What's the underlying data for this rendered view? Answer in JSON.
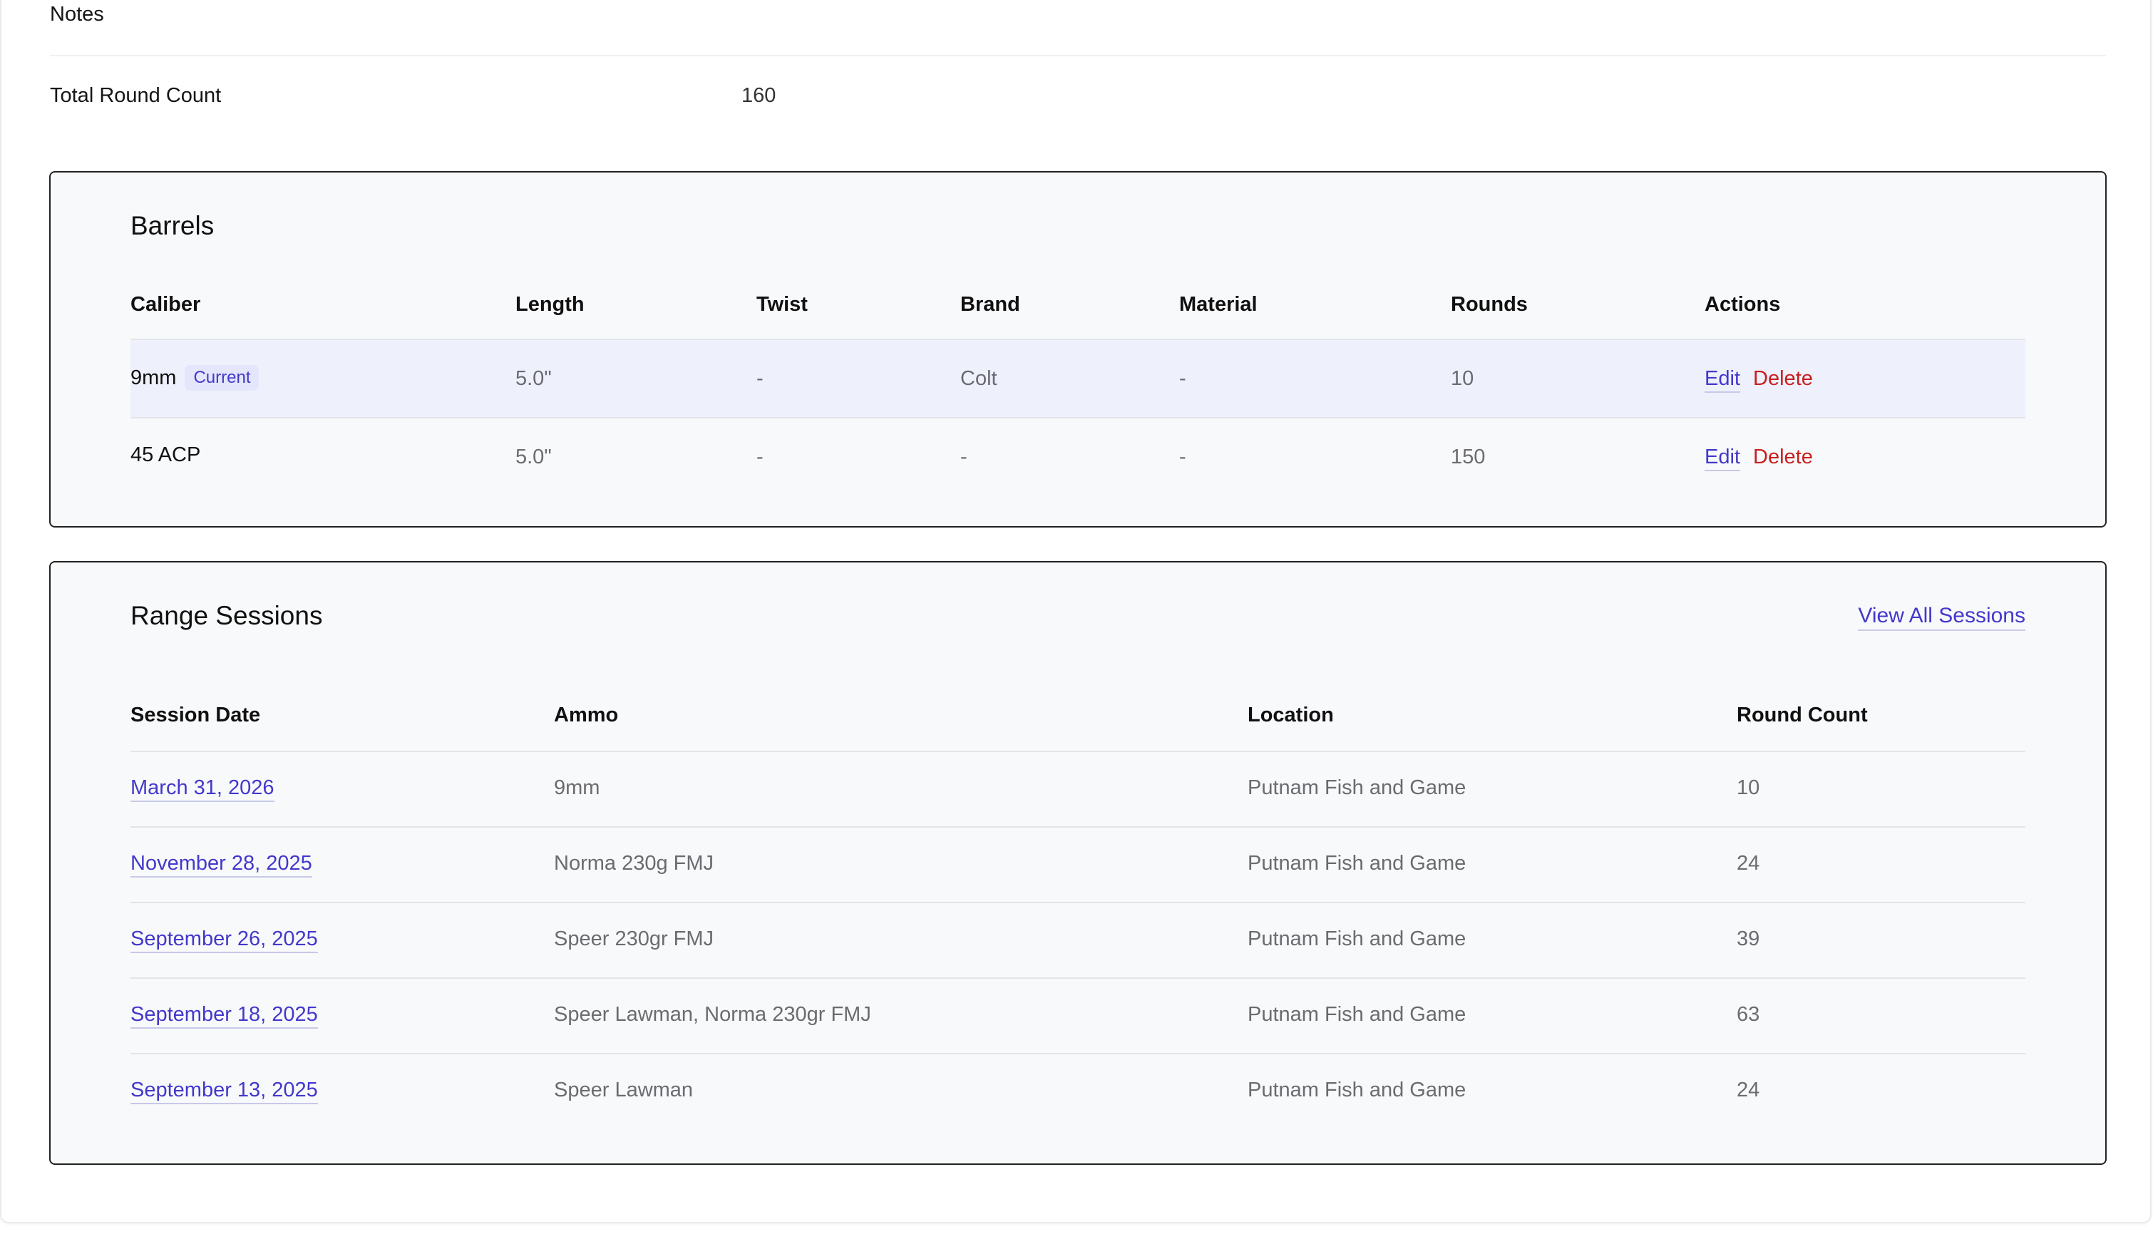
{
  "details": {
    "notes_label": "Notes",
    "total_label": "Total Round Count",
    "total_value": "160"
  },
  "barrels": {
    "title": "Barrels",
    "columns": [
      "Caliber",
      "Length",
      "Twist",
      "Brand",
      "Material",
      "Rounds",
      "Actions"
    ],
    "rows": [
      {
        "caliber": "9mm",
        "badge": "Current",
        "length": "5.0\"",
        "twist": "-",
        "brand": "Colt",
        "material": "-",
        "rounds": "10",
        "edit": "Edit",
        "delete": "Delete"
      },
      {
        "caliber": "45 ACP",
        "badge": "",
        "length": "5.0\"",
        "twist": "-",
        "brand": "-",
        "material": "-",
        "rounds": "150",
        "edit": "Edit",
        "delete": "Delete"
      }
    ]
  },
  "sessions": {
    "title": "Range Sessions",
    "view_all": "View All Sessions",
    "columns": [
      "Session Date",
      "Ammo",
      "Location",
      "Round Count"
    ],
    "rows": [
      {
        "date": "March 31, 2026",
        "ammo": "9mm",
        "location": "Putnam Fish and Game",
        "rounds": "10"
      },
      {
        "date": "November 28, 2025",
        "ammo": "Norma 230g FMJ",
        "location": "Putnam Fish and Game",
        "rounds": "24"
      },
      {
        "date": "September 26, 2025",
        "ammo": "Speer 230gr FMJ",
        "location": "Putnam Fish and Game",
        "rounds": "39"
      },
      {
        "date": "September 18, 2025",
        "ammo": "Speer Lawman, Norma 230gr FMJ",
        "location": "Putnam Fish and Game",
        "rounds": "63"
      },
      {
        "date": "September 13, 2025",
        "ammo": "Speer Lawman",
        "location": "Putnam Fish and Game",
        "rounds": "24"
      }
    ]
  },
  "colors": {
    "link": "#4338ca",
    "danger": "#c81e1e",
    "badge_bg": "#e4e6fb",
    "current_row_bg": "#eef0fc"
  }
}
